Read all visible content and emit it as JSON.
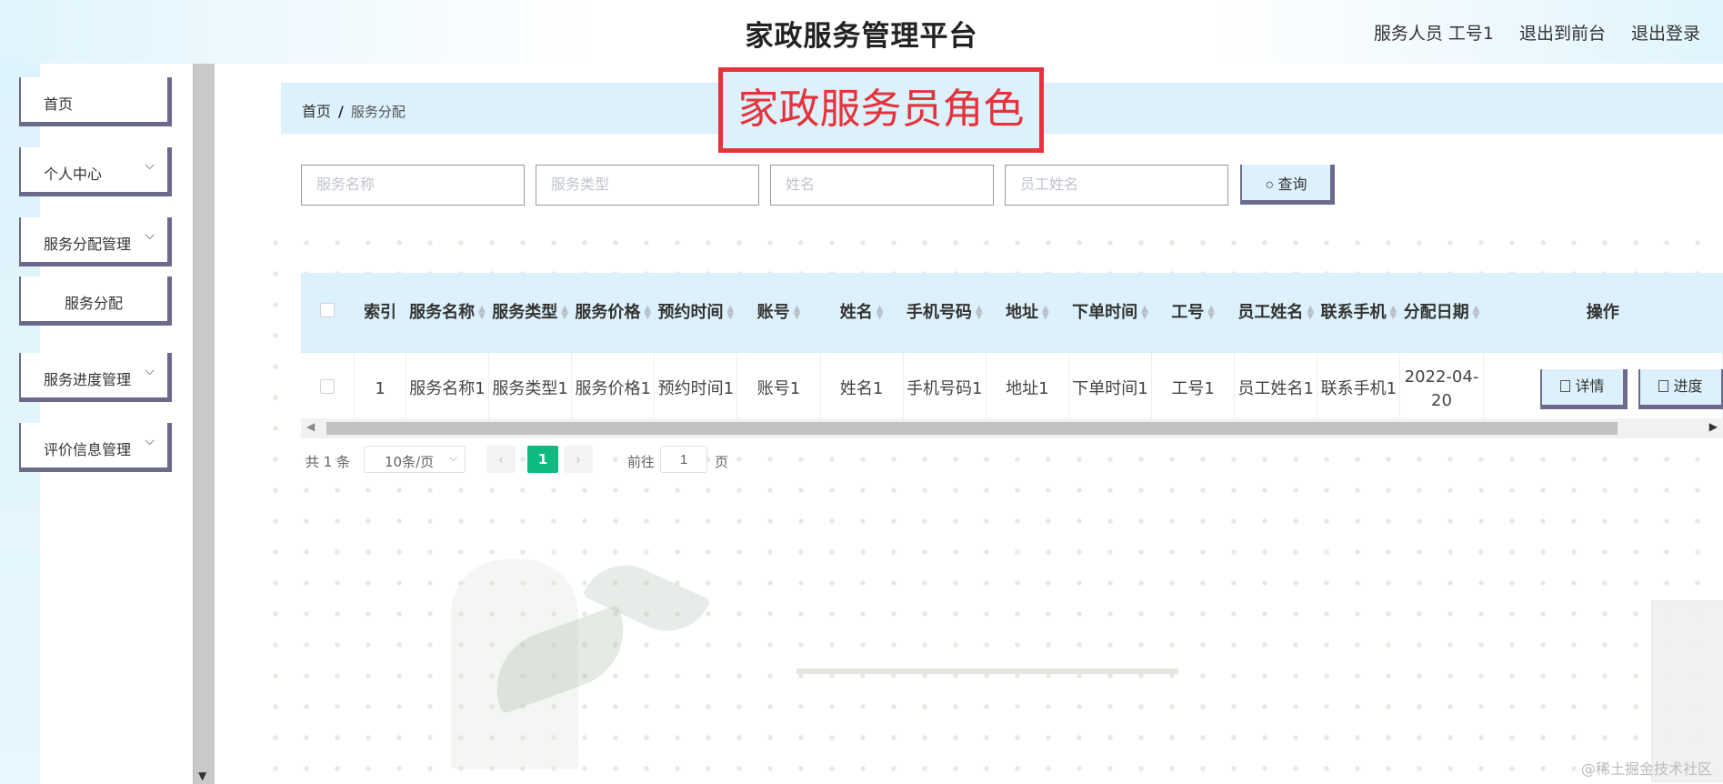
{
  "header": {
    "title": "家政服务管理平台",
    "user_label": "服务人员 工号1",
    "to_front": "退出到前台",
    "logout": "退出登录"
  },
  "sidebar": {
    "items": [
      {
        "label": "首页",
        "chevron": false
      },
      {
        "label": "个人中心",
        "chevron": true
      },
      {
        "label": "服务分配管理",
        "chevron": true
      },
      {
        "label": "服务分配",
        "chevron": false
      },
      {
        "label": "服务进度管理",
        "chevron": true
      },
      {
        "label": "评价信息管理",
        "chevron": true
      }
    ]
  },
  "breadcrumb": {
    "home": "首页",
    "sep": "/",
    "current": "服务分配"
  },
  "role_annotation": "家政服务员角色",
  "search": {
    "service_name_placeholder": "服务名称",
    "service_type_placeholder": "服务类型",
    "name_placeholder": "姓名",
    "staff_name_placeholder": "员工姓名",
    "query_label": "查询"
  },
  "table": {
    "columns": [
      "索引",
      "服务名称",
      "服务类型",
      "服务价格",
      "预约时间",
      "账号",
      "姓名",
      "手机号码",
      "地址",
      "下单时间",
      "工号",
      "员工姓名",
      "联系手机",
      "分配日期",
      "操作"
    ],
    "rows": [
      {
        "index": "1",
        "service_name": "服务名称1",
        "service_type": "服务类型1",
        "service_price": "服务价格1",
        "appointment_time": "预约时间1",
        "account": "账号1",
        "name": "姓名1",
        "phone": "手机号码1",
        "address": "地址1",
        "order_time": "下单时间1",
        "staff_no": "工号1",
        "staff_name": "员工姓名1",
        "contact_phone": "联系手机1",
        "assign_date": "2022-04-20"
      }
    ],
    "actions": {
      "detail": "详情",
      "progress": "进度"
    }
  },
  "pagination": {
    "total": "共 1 条",
    "page_size": "10条/页",
    "current_page": "1",
    "goto_label": "前往",
    "goto_value": "1",
    "page_unit": "页"
  },
  "watermark": "@稀土掘金技术社区"
}
